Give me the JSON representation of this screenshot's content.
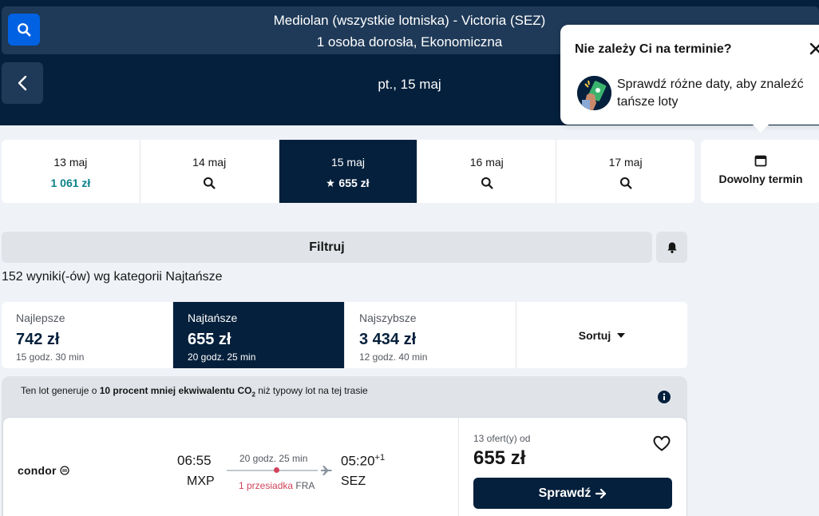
{
  "header": {
    "route": "Mediolan (wszystkie lotniska) - Victoria (SEZ)",
    "passengers": "1 osoba dorosła, Ekonomiczna",
    "selected_date": "pt., 15 maj"
  },
  "tooltip": {
    "title": "Nie zależy Ci na terminie?",
    "text": "Sprawdź różne daty, aby znaleźć tańsze loty"
  },
  "date_strip": {
    "dates": [
      {
        "date": "13 maj",
        "price": "1 061 zł"
      },
      {
        "date": "14 maj"
      },
      {
        "date": "15 maj",
        "price": "655 zł"
      },
      {
        "date": "16 maj"
      },
      {
        "date": "17 maj"
      }
    ],
    "any_date_label": "Dowolny termin"
  },
  "filters": {
    "filter_label": "Filtruj",
    "results_text": "152 wyniki(-ów) wg kategorii Najtańsze"
  },
  "sort_tabs": [
    {
      "title": "Najlepsze",
      "price": "742 zł",
      "duration": "15 godz. 30 min"
    },
    {
      "title": "Najtańsze",
      "price": "655 zł",
      "duration": "20 godz. 25 min"
    },
    {
      "title": "Najszybsze",
      "price": "3 434 zł",
      "duration": "12 godz. 40 min"
    }
  ],
  "sort_label": "Sortuj",
  "eco": {
    "prefix": "Ten lot generuje o ",
    "bold": "10 procent mniej ekwiwalentu CO",
    "sub": "2",
    "suffix": " niż typowy lot na tej trasie"
  },
  "flight": {
    "airline": "condor",
    "dep_time": "06:55",
    "dep_code": "MXP",
    "duration": "20 godz. 25 min",
    "stops": "1 przesiadka",
    "via": "FRA",
    "arr_time": "05:20",
    "arr_day_offset": "+1",
    "arr_code": "SEZ",
    "offers": "13 ofert(y) od",
    "price": "655 zł",
    "cta": "Sprawdź"
  },
  "colors": {
    "navy": "#05203c",
    "blue": "#0062e3",
    "green_price": "#0c838a",
    "stop_red": "#d1435b"
  }
}
